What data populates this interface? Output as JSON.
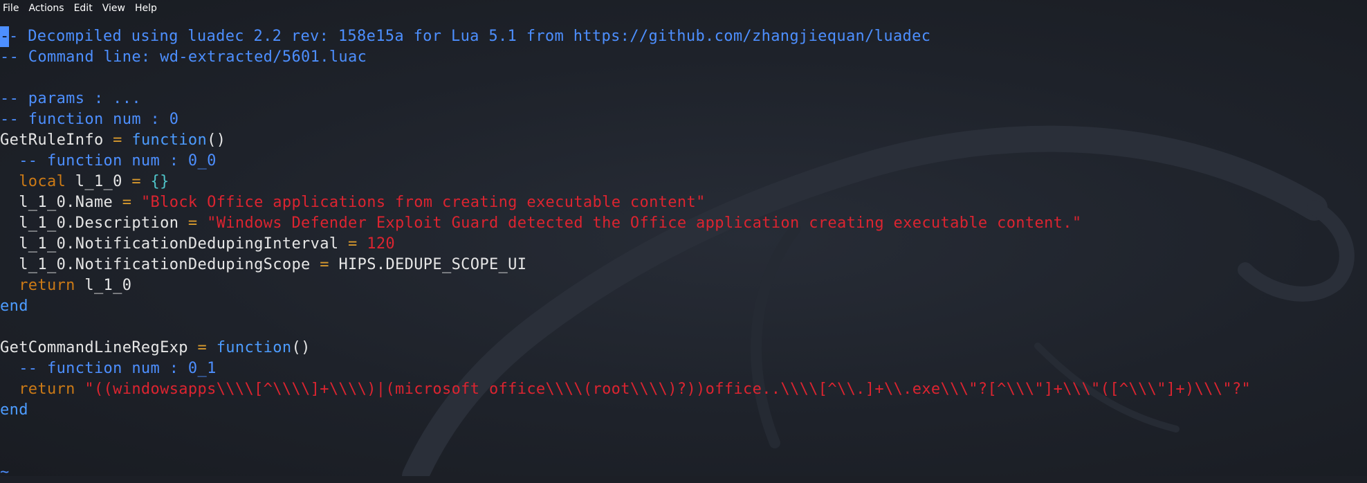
{
  "menu": {
    "items": [
      "File",
      "Actions",
      "Edit",
      "View",
      "Help"
    ]
  },
  "editor": {
    "cursor_char": "-",
    "lines": [
      {
        "n": 1,
        "segments": [
          {
            "t": "- Decompiled using luadec 2.2 rev: 158e15a for Lua 5.1 from https://github.com/zhangjiequan/luadec",
            "k": "comment"
          }
        ]
      },
      {
        "n": 2,
        "segments": [
          {
            "t": "-- Command line: wd-extracted/5601.luac",
            "k": "comment"
          }
        ]
      },
      {
        "n": 3,
        "segments": []
      },
      {
        "n": 4,
        "segments": [
          {
            "t": "-- params : ...",
            "k": "comment"
          }
        ]
      },
      {
        "n": 5,
        "segments": [
          {
            "t": "-- function num : 0",
            "k": "comment"
          }
        ]
      },
      {
        "n": 6,
        "segments": [
          {
            "t": "GetRuleInfo ",
            "k": "ident"
          },
          {
            "t": "=",
            "k": "op"
          },
          {
            "t": " function",
            "k": "fn"
          },
          {
            "t": "()",
            "k": "ident"
          }
        ]
      },
      {
        "n": 7,
        "segments": [
          {
            "t": "  -- function num : 0_0",
            "k": "comment"
          }
        ]
      },
      {
        "n": 8,
        "segments": [
          {
            "t": "  local",
            "k": "kw"
          },
          {
            "t": " l_1_0 ",
            "k": "ident"
          },
          {
            "t": "=",
            "k": "op"
          },
          {
            "t": " {}",
            "k": "brace"
          }
        ]
      },
      {
        "n": 9,
        "segments": [
          {
            "t": "  l_1_0.Name ",
            "k": "ident"
          },
          {
            "t": "=",
            "k": "op"
          },
          {
            "t": " \"Block Office applications from creating executable content\"",
            "k": "str"
          }
        ]
      },
      {
        "n": 10,
        "segments": [
          {
            "t": "  l_1_0.Description ",
            "k": "ident"
          },
          {
            "t": "=",
            "k": "op"
          },
          {
            "t": " \"Windows Defender Exploit Guard detected the Office application creating executable content.\"",
            "k": "str"
          }
        ]
      },
      {
        "n": 11,
        "segments": [
          {
            "t": "  l_1_0.NotificationDedupingInterval ",
            "k": "ident"
          },
          {
            "t": "=",
            "k": "op"
          },
          {
            "t": " 120",
            "k": "num"
          }
        ]
      },
      {
        "n": 12,
        "segments": [
          {
            "t": "  l_1_0.NotificationDedupingScope ",
            "k": "ident"
          },
          {
            "t": "=",
            "k": "op"
          },
          {
            "t": " HIPS.DEDUPE_SCOPE_UI",
            "k": "ident"
          }
        ]
      },
      {
        "n": 13,
        "segments": [
          {
            "t": "  return",
            "k": "kw"
          },
          {
            "t": " l_1_0",
            "k": "ident"
          }
        ]
      },
      {
        "n": 14,
        "segments": [
          {
            "t": "end",
            "k": "end"
          }
        ]
      },
      {
        "n": 15,
        "segments": []
      },
      {
        "n": 16,
        "segments": [
          {
            "t": "GetCommandLineRegExp ",
            "k": "ident"
          },
          {
            "t": "=",
            "k": "op"
          },
          {
            "t": " function",
            "k": "fn"
          },
          {
            "t": "()",
            "k": "ident"
          }
        ]
      },
      {
        "n": 17,
        "segments": [
          {
            "t": "  -- function num : 0_1",
            "k": "comment"
          }
        ]
      },
      {
        "n": 18,
        "segments": [
          {
            "t": "  return",
            "k": "kw"
          },
          {
            "t": " \"((windowsapps\\\\\\\\[^\\\\\\\\]+\\\\\\\\)|(microsoft office\\\\\\\\(root\\\\\\\\)?))office..\\\\\\\\[^\\\\.]+\\\\.exe\\\\\\\"?[^\\\\\\\"]+\\\\\\\"([^\\\\\\\"]+)\\\\\\\"?\"",
            "k": "str"
          }
        ]
      },
      {
        "n": 19,
        "segments": [
          {
            "t": "end",
            "k": "end"
          }
        ]
      },
      {
        "n": 20,
        "segments": []
      },
      {
        "n": 21,
        "segments": []
      },
      {
        "n": 22,
        "segments": [
          {
            "t": "~",
            "k": "tilde"
          }
        ]
      }
    ]
  },
  "colors": {
    "background": "#1c1f26",
    "comment": "#4d8fff",
    "identifier": "#e6e6e6",
    "function_keyword": "#4d9cff",
    "operator": "#d99a2e",
    "keyword": "#cc7a16",
    "string": "#dc2430",
    "brace": "#4fc4c8"
  }
}
